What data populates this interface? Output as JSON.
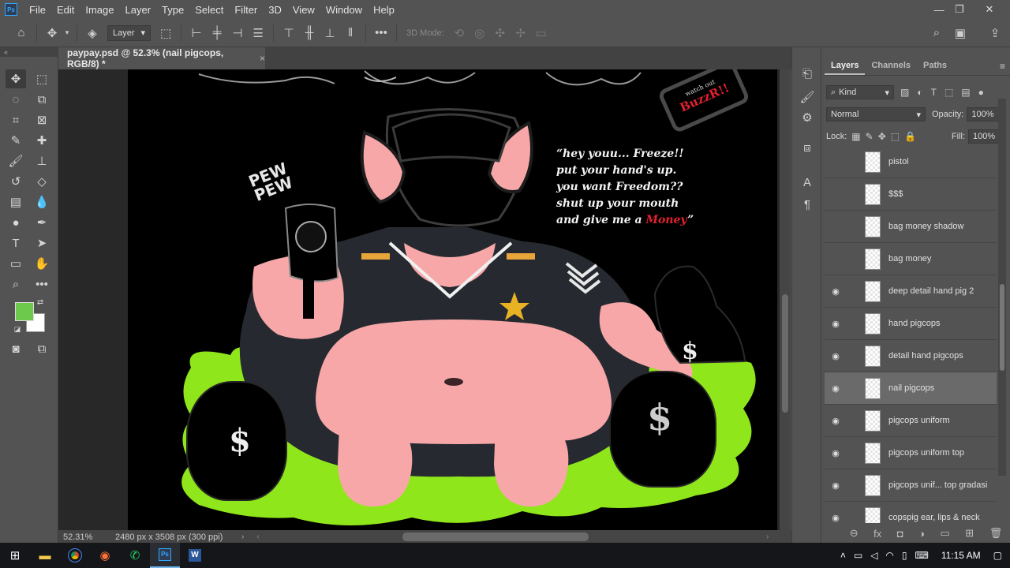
{
  "app": {
    "logo": "Ps"
  },
  "menu": [
    "File",
    "Edit",
    "Image",
    "Layer",
    "Type",
    "Select",
    "Filter",
    "3D",
    "View",
    "Window",
    "Help"
  ],
  "window_controls": {
    "minimize": "—",
    "restore": "❐",
    "close": "✕"
  },
  "options_bar": {
    "auto_select_target": "Layer",
    "mode_3d_label": "3D Mode:"
  },
  "document": {
    "tab_title": "paypay.psd @ 52.3% (nail pigcops, RGB/8) *",
    "tab_close": "×"
  },
  "status": {
    "zoom": "52.31%",
    "doc_info": "2480 px x 3508 px (300 ppi)"
  },
  "artwork": {
    "quote_lines": [
      "“hey youu... Freeze!!",
      "put your hand's up.",
      "you want Freedom??",
      "shut up your mouth"
    ],
    "quote_last_prefix": "and give me a ",
    "quote_last_highlight": "Money",
    "quote_last_suffix": "”",
    "pew_top": "PEW",
    "pew_bottom": "PEW",
    "sign_top": "watch out",
    "sign_bottom": "BuzzR!!",
    "dollar_glyph": "$"
  },
  "layers_panel": {
    "tabs": [
      "Layers",
      "Channels",
      "Paths"
    ],
    "filter_kind": "Kind",
    "blend_mode": "Normal",
    "opacity_label": "Opacity:",
    "opacity_value": "100%",
    "lock_label": "Lock:",
    "fill_label": "Fill:",
    "fill_value": "100%",
    "layers": [
      {
        "name": "pistol",
        "visible": false,
        "selected": false
      },
      {
        "name": "$$$",
        "visible": false,
        "selected": false
      },
      {
        "name": "bag money shadow",
        "visible": false,
        "selected": false
      },
      {
        "name": "bag money",
        "visible": false,
        "selected": false
      },
      {
        "name": "deep detail hand pig 2",
        "visible": true,
        "selected": false
      },
      {
        "name": "hand pigcops",
        "visible": true,
        "selected": false
      },
      {
        "name": "detail hand pigcops",
        "visible": true,
        "selected": false
      },
      {
        "name": "nail pigcops",
        "visible": true,
        "selected": true
      },
      {
        "name": "pigcops uniform",
        "visible": true,
        "selected": false
      },
      {
        "name": "pigcops uniform top",
        "visible": true,
        "selected": false
      },
      {
        "name": "pigcops unif... top gradasi",
        "visible": true,
        "selected": false
      },
      {
        "name": "copspig ear, lips & neck",
        "visible": true,
        "selected": false
      }
    ],
    "footer": [
      "⊖",
      "fx",
      "◘",
      "◑",
      "▭",
      "⊞",
      "🗑"
    ]
  },
  "taskbar": {
    "time": "11:15 AM"
  },
  "colors": {
    "foreground": "#6cc94c",
    "background": "#ffffff",
    "slime": "#8fe61b",
    "pig_pink": "#f7a7a7",
    "accent_red": "#e3202e"
  }
}
